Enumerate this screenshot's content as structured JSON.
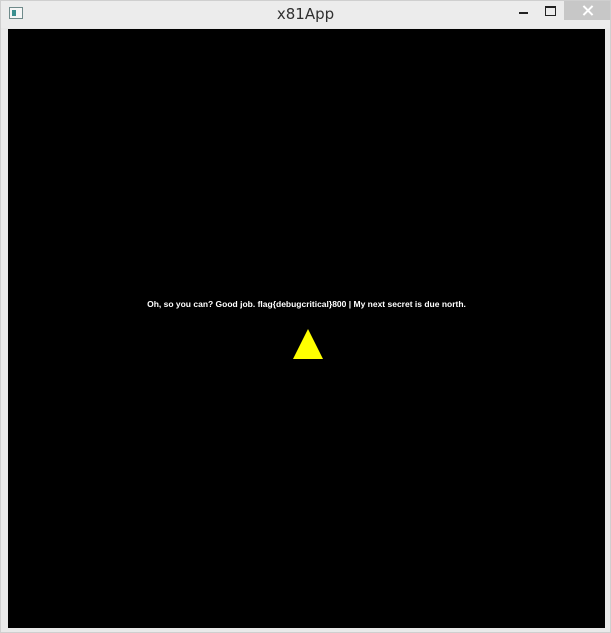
{
  "window": {
    "title": "x81App"
  },
  "titlebar": {
    "icon": "app-icon",
    "controls": {
      "minimize_icon": "minimize-icon",
      "maximize_icon": "maximize-icon",
      "close_icon": "close-icon"
    }
  },
  "canvas": {
    "background_color": "#000000",
    "message": "Oh, so you can? Good job. flag{debugcritical}800 | My next secret is due north.",
    "player_color": "#ffff00",
    "player_shape": "triangle"
  }
}
